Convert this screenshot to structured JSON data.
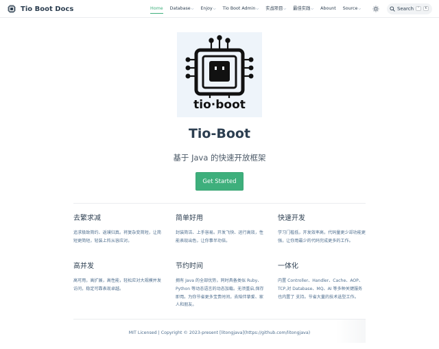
{
  "site": {
    "title": "Tio Boot Docs"
  },
  "nav": {
    "items": [
      {
        "label": "Home",
        "active": true,
        "dropdown": false
      },
      {
        "label": "Database",
        "dropdown": true
      },
      {
        "label": "Enjoy",
        "dropdown": true
      },
      {
        "label": "Tio Boot Admin",
        "dropdown": true
      },
      {
        "label": "实战项目",
        "dropdown": true
      },
      {
        "label": "最佳实践",
        "dropdown": true
      },
      {
        "label": "Abount",
        "dropdown": false
      },
      {
        "label": "Source",
        "dropdown": true
      }
    ],
    "search": {
      "label": "Search",
      "kbd_mod": "⌃",
      "kbd_key": "K"
    }
  },
  "hero": {
    "logo_text": "tio·boot",
    "title": "Tio-Boot",
    "description": "基于 Java 的快速开放框架",
    "action": "Get Started"
  },
  "features": [
    {
      "title": "去繁求减",
      "details": "追求极致简约、返璞归真。将复杂变简短，让简短更简短，轻装上阵从容应对。"
    },
    {
      "title": "简单好用",
      "details": "封装简洁、上手容易。开发飞快、运行高效，性能表现出色，让你事半功倍。"
    },
    {
      "title": "快速开发",
      "details": "学习门槛低，开发效率高，代码量更少却功能更强，让你用最少的代码完成更多的工作。"
    },
    {
      "title": "高并发",
      "details": "高可用，高扩展，高性能，轻松应对大规模并发访问，稳定可靠表现卓越。"
    },
    {
      "title": "节约时间",
      "details": "拥有 Java 的全部优势，同时具备类似 Ruby、Python 等动态语言的动态加载。无须重启,保存即用。为你节省更多宝贵时间，去陪伴挚爱、家人和朋友。"
    },
    {
      "title": "一体化",
      "details": "内置 Controller、Handler、Cache、AOP、TCP,对 Database、MQ、AI 等多种关键服务 也内置了 支持。节省大量的技术选型工作。"
    }
  ],
  "footer": {
    "text": "MIT Licensed | Copyright © 2023-present [litongjava](https://github.com/litongjava)"
  },
  "colors": {
    "accent": "#3eaf7c",
    "text": "#2c3e50",
    "muted": "#4e6e8e"
  }
}
